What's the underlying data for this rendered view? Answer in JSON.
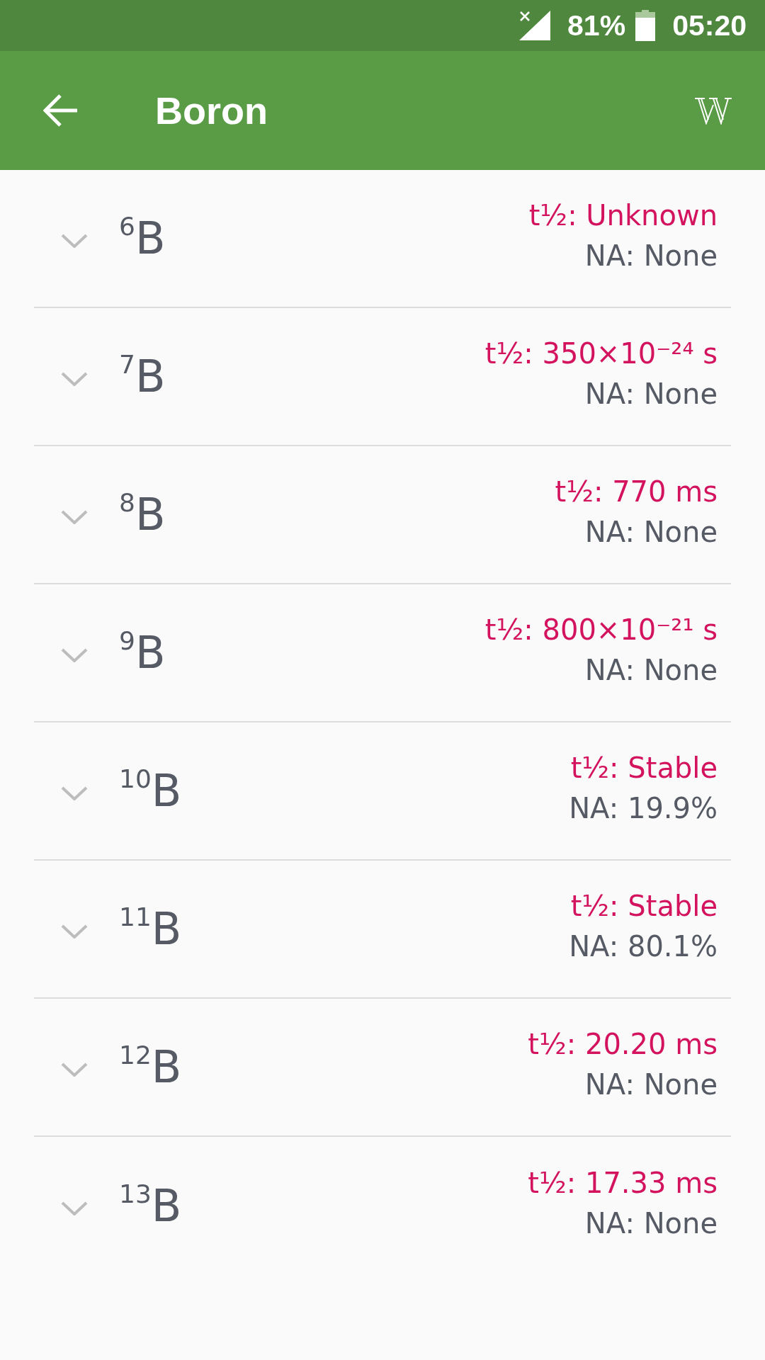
{
  "status_bar": {
    "battery": "81%",
    "time": "05:20"
  },
  "app_bar": {
    "title": "Boron"
  },
  "isotopes": [
    {
      "label": "$^{6}$B",
      "half_life": "t½: Unknown",
      "abundance": "NA: None",
      "expanded": false
    },
    {
      "label": "$^{7}$B",
      "half_life": "t½: 350×10⁻²⁴ s",
      "abundance": "NA: None",
      "expanded": false
    },
    {
      "label": "$^{8}$B",
      "half_life": "t½: 770 ms",
      "abundance": "NA: None",
      "expanded": false
    },
    {
      "label": "$^{9}$B",
      "half_life": "t½: 800×10⁻²¹ s",
      "abundance": "NA: None",
      "expanded": false
    },
    {
      "label": "$^{10}$B",
      "half_life": "t½: Stable",
      "abundance": "NA: 19.9%",
      "expanded": false
    },
    {
      "label": "$^{11}$B",
      "half_life": "t½: Stable",
      "abundance": "NA: 80.1%",
      "expanded": false
    },
    {
      "label": "$^{12}$B",
      "half_life": "t½: 20.20 ms",
      "abundance": "NA: None",
      "expanded": false
    },
    {
      "label": "$^{13}$B",
      "half_life": "t½: 17.33 ms",
      "abundance": "NA: None",
      "expanded": false
    }
  ]
}
